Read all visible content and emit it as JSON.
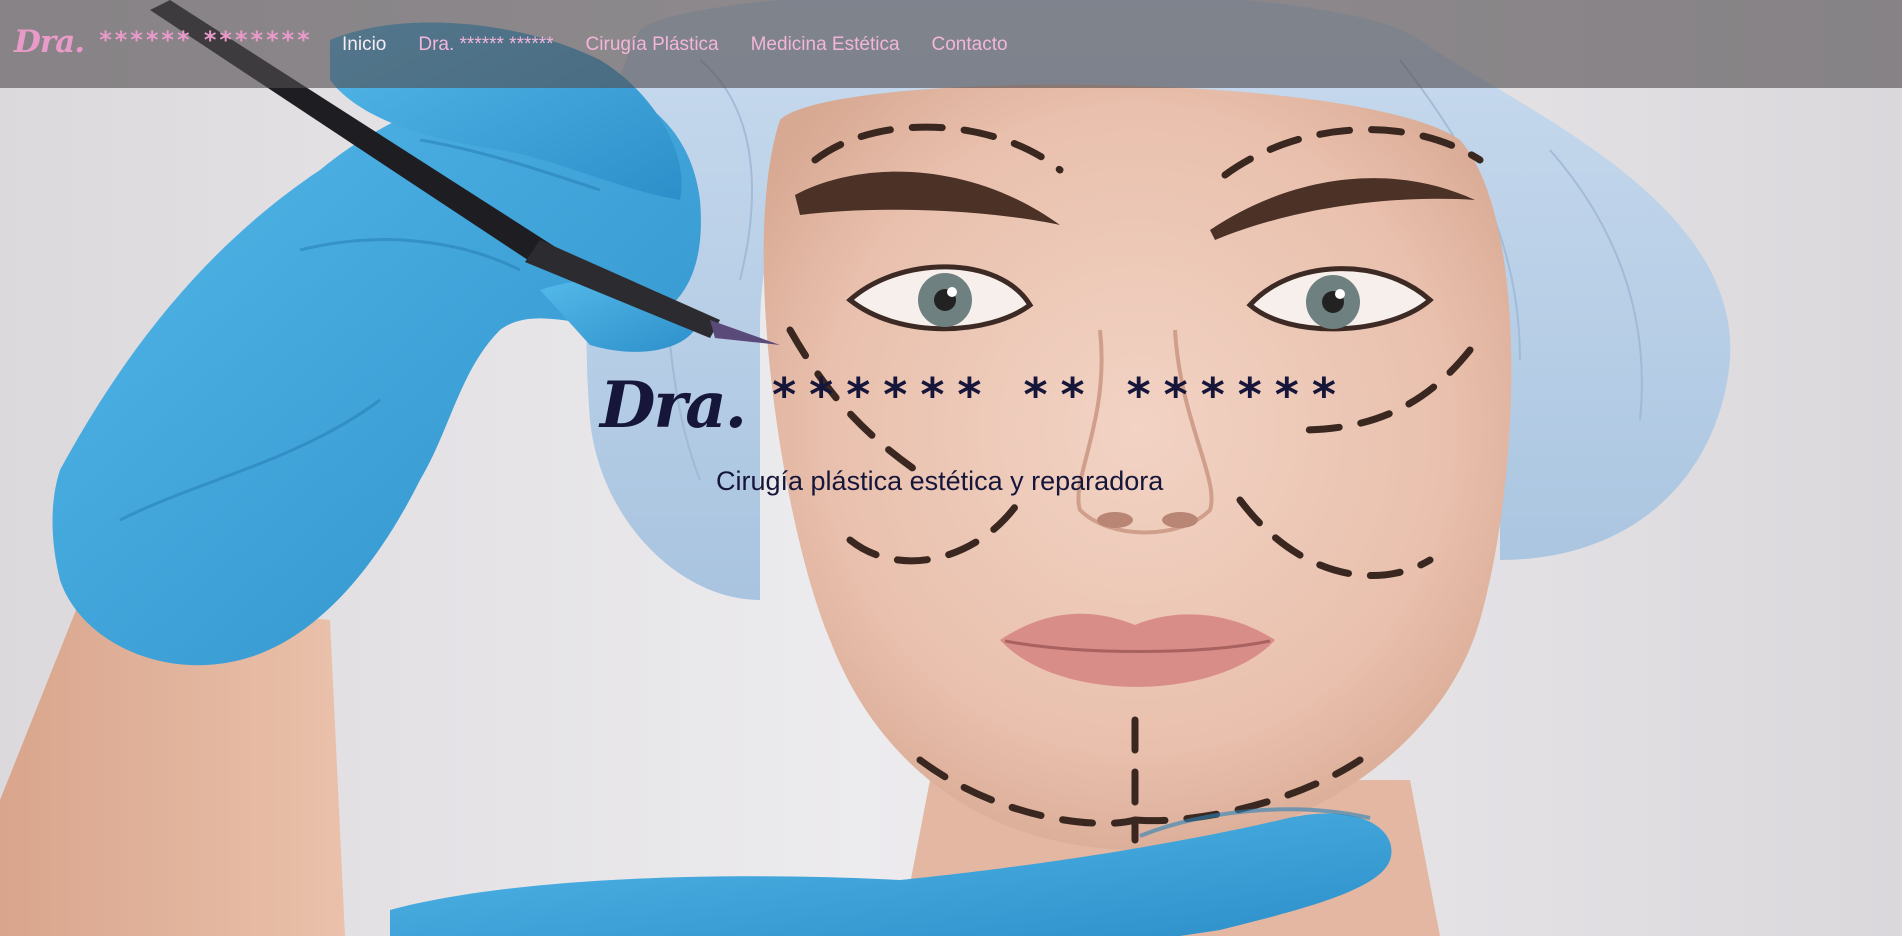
{
  "navbar": {
    "brand_script": "Dra.",
    "brand_stars": "****** *******",
    "links": [
      {
        "label": "Inicio"
      },
      {
        "label": "Dra. ****** ******"
      },
      {
        "label": "Cirugía Plástica"
      },
      {
        "label": "Medicina Estética"
      },
      {
        "label": "Contacto"
      }
    ]
  },
  "hero": {
    "title_script": "Dra.",
    "title_stars": "****** ** ******",
    "subtitle": "Cirugía plástica estética y reparadora"
  },
  "colors": {
    "brand_pink": "#e89ac8",
    "nav_link": "#f3b6da",
    "nav_active": "#f4eef3",
    "hero_text": "#16163a",
    "glove_blue": "#3aa6dc"
  },
  "icons": {
    "hero_image": "face-with-surgical-markings-image"
  }
}
